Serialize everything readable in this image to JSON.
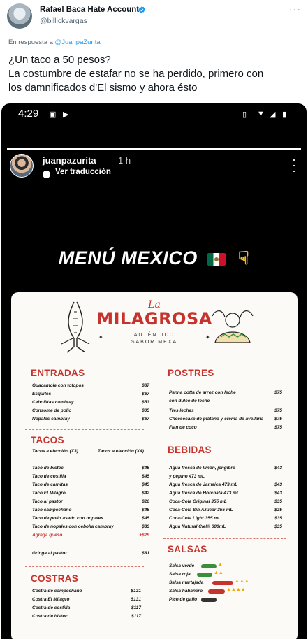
{
  "tweet": {
    "author_name": "Rafael Baca Hate Account",
    "author_handle": "@billickvargas",
    "reply_prefix": "En respuesta a",
    "reply_mention": "@JuanpaZurita",
    "text_lines": [
      "¿Un taco a 50 pesos?",
      "La costumbre de estafar no se ha perdido, primero con",
      "los damnificados d'El sismo y ahora ésto"
    ]
  },
  "story": {
    "status_time": "4:29",
    "username": "juanpazurita",
    "posted_ago": "1 h",
    "translate_label": "Ver traducción",
    "progress_fraction": 1.0,
    "headline": "MENÚ MEXICO"
  },
  "menu": {
    "brand_small": "La",
    "brand_name": "MILAGROSA",
    "brand_sub1": "AUTÉNTICO",
    "brand_sub2": "SABOR MEXA",
    "entradas": {
      "title": "ENTRADAS",
      "items": [
        {
          "name": "Guacamole con totopos",
          "price": "$87"
        },
        {
          "name": "Esquites",
          "price": "$67"
        },
        {
          "name": "Cebollitas cambray",
          "price": "$53"
        },
        {
          "name": "Consomé de pollo",
          "price": "$95"
        },
        {
          "name": "Nopales cambray",
          "price": "$67"
        }
      ]
    },
    "tacos": {
      "title": "TACOS",
      "sub_left": "Tacos a elección (X3)",
      "sub_right": "Tacos a elección (X4)",
      "items": [
        {
          "name": "Taco de bistec",
          "price": "$45"
        },
        {
          "name": "Taco de costilla",
          "price": "$45"
        },
        {
          "name": "Taco de carnitas",
          "price": "$45"
        },
        {
          "name": "Taco El Milagro",
          "price": "$42"
        },
        {
          "name": "Taco al pastor",
          "price": "$26"
        },
        {
          "name": "Taco campechano",
          "price": "$45"
        },
        {
          "name": "Taco de pollo asado con nopales",
          "price": "$45"
        },
        {
          "name": "Taco de nopales con cebolla cambray",
          "price": "$39"
        }
      ],
      "extra": {
        "name": "Agrega queso",
        "price": "+$29"
      },
      "gringa": {
        "name": "Gringa al pastor",
        "price": "$81"
      }
    },
    "costras": {
      "title": "COSTRAS",
      "items": [
        {
          "name": "Costra de campechano",
          "price": "$131"
        },
        {
          "name": "Costra El Milagro",
          "price": "$131"
        },
        {
          "name": "Costra de costilla",
          "price": "$117"
        },
        {
          "name": "Costra de bistec",
          "price": "$117"
        }
      ]
    },
    "postres": {
      "title": "POSTRES",
      "items": [
        {
          "name": "Panna cotta de arroz con leche",
          "name2": "con dulce de leche",
          "price": "$75"
        },
        {
          "name": "Tres leches",
          "price": "$75"
        },
        {
          "name": "Cheesecake de plátano y crema de avellana",
          "price": "$75"
        },
        {
          "name": "Flan de coco",
          "price": "$75"
        }
      ]
    },
    "bebidas": {
      "title": "BEBIDAS",
      "items": [
        {
          "name": "Agua fresca de limón, jengibre",
          "name2": "y pepino 473 mL",
          "price": "$43"
        },
        {
          "name": "Agua fresca de Jamaica 473 mL",
          "price": "$43"
        },
        {
          "name": "Agua fresca de Horchata 473 mL",
          "price": "$43"
        },
        {
          "name": "Coca-Cola Original 355 mL",
          "price": "$35"
        },
        {
          "name": "Coca-Cola Sin Azúcar 355 mL",
          "price": "$35"
        },
        {
          "name": "Coca-Cola Light 355 mL",
          "price": "$35"
        },
        {
          "name": "Agua Natural Ciel® 600mL",
          "price": "$35"
        }
      ]
    },
    "salsas": {
      "title": "SALSAS",
      "items": [
        {
          "name": "Salsa verde"
        },
        {
          "name": "Salsa roja"
        },
        {
          "name": "Salsa martajada"
        },
        {
          "name": "Salsa habanero"
        },
        {
          "name": "Pico de gallo"
        }
      ]
    }
  },
  "colors": {
    "accent_red": "#c8322c",
    "link_blue": "#1d9bf0"
  }
}
